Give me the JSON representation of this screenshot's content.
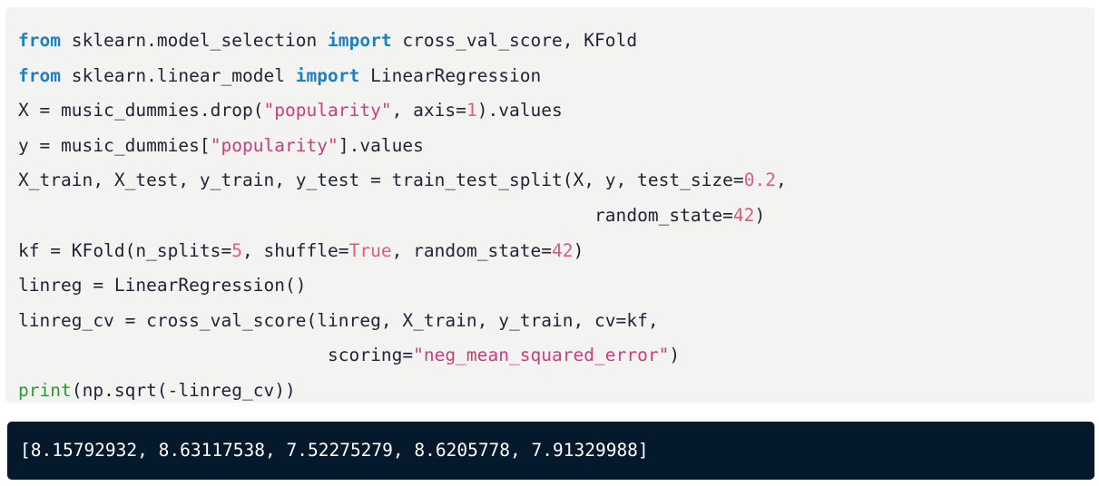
{
  "code": {
    "l1": {
      "kw1": "from",
      "t1": " sklearn.model_selection ",
      "kw2": "import",
      "t2": " cross_val_score, KFold"
    },
    "l2": {
      "kw1": "from",
      "t1": " sklearn.linear_model ",
      "kw2": "import",
      "t2": " LinearRegression"
    },
    "l3": {
      "t1": "X = music_dummies.drop(",
      "s1": "\"popularity\"",
      "t2": ", axis=",
      "n1": "1",
      "t3": ").values"
    },
    "l4": {
      "t1": "y = music_dummies[",
      "s1": "\"popularity\"",
      "t2": "].values"
    },
    "l5": {
      "t1": "X_train, X_test, y_train, y_test = train_test_split(X, y, test_size=",
      "n1": "0.2",
      "t2": ","
    },
    "l6": {
      "t1": "                                                      random_state=",
      "n1": "42",
      "t2": ")"
    },
    "l7": {
      "t1": "kf = KFold(n_splits=",
      "n1": "5",
      "t2": ", shuffle=",
      "n2": "True",
      "t3": ", random_state=",
      "n3": "42",
      "t4": ")"
    },
    "l8": {
      "t1": "linreg = LinearRegression()"
    },
    "l9": {
      "t1": "linreg_cv = cross_val_score(linreg, X_train, y_train, cv=kf,"
    },
    "l10": {
      "t1": "                             scoring=",
      "s1": "\"neg_mean_squared_error\"",
      "t2": ")"
    },
    "l11": {
      "f1": "print",
      "t1": "(np.sqrt(-linreg_cv))"
    }
  },
  "output": {
    "text": "[8.15792932, 8.63117538, 7.52275279, 8.6205778, 7.91329988]"
  },
  "colors": {
    "code_background": "#f3f3f1",
    "output_background": "#05192d",
    "keyword": "#1f7fbf",
    "string": "#c83f7a",
    "number": "#e15b7e",
    "builtin_function": "#2e9b32"
  }
}
